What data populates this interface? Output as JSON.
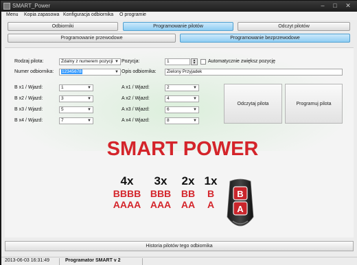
{
  "window": {
    "title": "SMART_Power"
  },
  "menu": [
    "Menu",
    "Kopia zapasowa",
    "Konfiguracja odbiornika",
    "O programie"
  ],
  "nav": {
    "row1": [
      "Odbiorniki",
      "Programowanie pilotów",
      "Odczyt pilotów"
    ],
    "row2": [
      "Programowanie przewodowe",
      "Programowanie bezprzewodowe"
    ],
    "active_row1": "Programowanie pilotów",
    "active_row2": "Programowanie bezprzewodowe"
  },
  "form": {
    "remote_type_label": "Rodzaj pilota:",
    "remote_type_value": "Zdalny z numerem pozycji",
    "position_label": "Pozycja:",
    "position_value": "1",
    "auto_increment_label": "Automatycznie zwiększ pozycję",
    "auto_increment_checked": false,
    "receiver_number_label": "Numer odbiornika:",
    "receiver_number_value": "12345678",
    "receiver_desc_label": "Opis odbiornika:",
    "receiver_desc_value": "Zielony Przyjadek",
    "b_inputs": [
      {
        "label": "B x1 / Wjazd:",
        "value": "1"
      },
      {
        "label": "B x2 / Wjazd:",
        "value": "3"
      },
      {
        "label": "B x3 / Wjazd:",
        "value": "5"
      },
      {
        "label": "B x4 / Wjazd:",
        "value": "7"
      }
    ],
    "a_inputs": [
      {
        "label": "A x1 / Wjazd:",
        "value": "2"
      },
      {
        "label": "A x2 / Wjazd:",
        "value": "4"
      },
      {
        "label": "A x3 / Wjazd:",
        "value": "6"
      },
      {
        "label": "A x4 / Wjazd:",
        "value": "8"
      }
    ]
  },
  "actions": {
    "read_remote": "Odczytaj pilota",
    "program_remote": "Programuj pilota"
  },
  "brand": "SMART POWER",
  "combos": [
    {
      "count": "4x",
      "b": "BBBB",
      "a": "AAAA"
    },
    {
      "count": "3x",
      "b": "BBB",
      "a": "AAA"
    },
    {
      "count": "2x",
      "b": "BB",
      "a": "AA"
    },
    {
      "count": "1x",
      "b": "B",
      "a": "A"
    }
  ],
  "remote_keys": [
    "B",
    "A"
  ],
  "history_button": "Historia pilotów tego odbiornika",
  "status": {
    "datetime": "2013-06-03 16:31:49",
    "device": "Programator SMART v 2"
  },
  "colors": {
    "brand_red": "#d4242a",
    "active_tab": "#8fcdf3",
    "selection": "#3399ff"
  }
}
